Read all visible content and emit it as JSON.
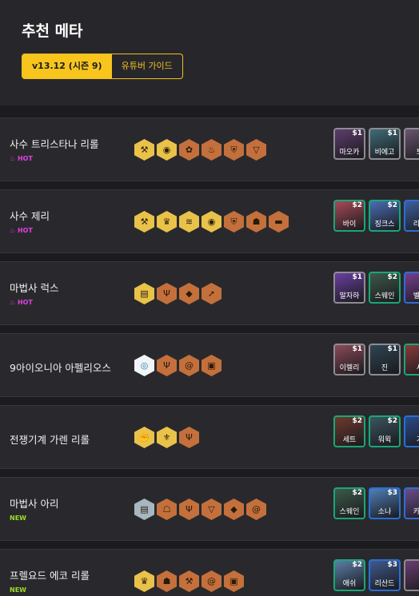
{
  "page": {
    "title": "추천 메타"
  },
  "tabs": [
    {
      "label": "v13.12 (시즌 9)",
      "active": true
    },
    {
      "label": "유튜버 가이드",
      "active": false
    }
  ],
  "comps": [
    {
      "name": "사수 트리스타나 리롤",
      "badge": "HOT",
      "traits": [
        {
          "tier": "gold",
          "icon": "hammer-icon"
        },
        {
          "tier": "gold",
          "icon": "cannon-icon"
        },
        {
          "tier": "bronze",
          "icon": "flower-icon"
        },
        {
          "tier": "bronze",
          "icon": "flame-icon"
        },
        {
          "tier": "bronze",
          "icon": "shield-icon"
        },
        {
          "tier": "bronze",
          "icon": "triangle-icon"
        }
      ],
      "champs": [
        {
          "name": "마오카",
          "cost": "$1",
          "color": "#5e3d6c"
        },
        {
          "name": "비에고",
          "cost": "$1",
          "color": "#3f6c78"
        },
        {
          "name": "뽀",
          "cost": "$1",
          "color": "#6a5470"
        }
      ]
    },
    {
      "name": "사수 제리",
      "badge": "HOT",
      "traits": [
        {
          "tier": "gold",
          "icon": "hammer-icon"
        },
        {
          "tier": "gold",
          "icon": "crown-icon"
        },
        {
          "tier": "gold",
          "icon": "wave-icon"
        },
        {
          "tier": "gold",
          "icon": "cannon-icon"
        },
        {
          "tier": "bronze",
          "icon": "shield-icon"
        },
        {
          "tier": "bronze",
          "icon": "mask-icon"
        },
        {
          "tier": "bronze",
          "icon": "dumbbell-icon"
        }
      ],
      "champs": [
        {
          "name": "바이",
          "cost": "$2",
          "color": "#a74a57"
        },
        {
          "name": "징크스",
          "cost": "$2",
          "color": "#4a6db5"
        },
        {
          "name": "리산",
          "cost": "$3",
          "color": "#3d5f9c"
        }
      ]
    },
    {
      "name": "마법사 럭스",
      "badge": "HOT",
      "traits": [
        {
          "tier": "gold",
          "icon": "book-icon"
        },
        {
          "tier": "bronze",
          "icon": "fork-icon"
        },
        {
          "tier": "bronze",
          "icon": "drop-icon"
        },
        {
          "tier": "bronze",
          "icon": "arrow-icon"
        }
      ],
      "champs": [
        {
          "name": "말자하",
          "cost": "$1",
          "color": "#6a3fa0"
        },
        {
          "name": "스웨인",
          "cost": "$2",
          "color": "#3d5a4a"
        },
        {
          "name": "벨코",
          "cost": "$3",
          "color": "#7a3e8e"
        }
      ]
    },
    {
      "name": "9아이오니아 아펠리오스",
      "badge": "",
      "traits": [
        {
          "tier": "prism",
          "icon": "ring-icon"
        },
        {
          "tier": "bronze",
          "icon": "fork-icon"
        },
        {
          "tier": "bronze",
          "icon": "spiral-icon"
        },
        {
          "tier": "bronze",
          "icon": "scroll-icon"
        }
      ],
      "champs": [
        {
          "name": "이렐리",
          "cost": "$1",
          "color": "#8c4a58"
        },
        {
          "name": "진",
          "cost": "$1",
          "color": "#2f4552"
        },
        {
          "name": "세",
          "cost": "$2",
          "color": "#8a3a3a"
        }
      ]
    },
    {
      "name": "전쟁기계 가렌 리롤",
      "badge": "",
      "traits": [
        {
          "tier": "gold",
          "icon": "fist-icon"
        },
        {
          "tier": "gold",
          "icon": "helmet-icon"
        },
        {
          "tier": "bronze",
          "icon": "fork-icon"
        }
      ],
      "champs": [
        {
          "name": "세트",
          "cost": "$2",
          "color": "#6e3a2e"
        },
        {
          "name": "워윅",
          "cost": "$2",
          "color": "#3b5560"
        },
        {
          "name": "가",
          "cost": "$3",
          "color": "#2a4b8a"
        }
      ]
    },
    {
      "name": "마법사 아리",
      "badge": "NEW",
      "traits": [
        {
          "tier": "silver",
          "icon": "book-icon"
        },
        {
          "tier": "bronze",
          "icon": "cloak-icon"
        },
        {
          "tier": "bronze",
          "icon": "fork-icon"
        },
        {
          "tier": "bronze",
          "icon": "triangle-icon"
        },
        {
          "tier": "bronze",
          "icon": "drop-icon"
        },
        {
          "tier": "bronze",
          "icon": "spiral-icon"
        }
      ],
      "champs": [
        {
          "name": "스웨인",
          "cost": "$2",
          "color": "#3d5a4a"
        },
        {
          "name": "소나",
          "cost": "$3",
          "color": "#4f7fb5"
        },
        {
          "name": "카르",
          "cost": "$3",
          "color": "#6c4b8c"
        }
      ]
    },
    {
      "name": "프렐요드 에코 리롤",
      "badge": "NEW",
      "traits": [
        {
          "tier": "gold",
          "icon": "crown-icon"
        },
        {
          "tier": "bronze",
          "icon": "mask-icon"
        },
        {
          "tier": "bronze",
          "icon": "hammer-icon"
        },
        {
          "tier": "bronze",
          "icon": "spiral-icon"
        },
        {
          "tier": "bronze",
          "icon": "scroll-icon"
        }
      ],
      "champs": [
        {
          "name": "애쉬",
          "cost": "$2",
          "color": "#5d7fa8"
        },
        {
          "name": "리산드",
          "cost": "$3",
          "color": "#3f5a8e"
        },
        {
          "name": "",
          "cost": "",
          "color": "#6a3d70"
        }
      ]
    }
  ]
}
